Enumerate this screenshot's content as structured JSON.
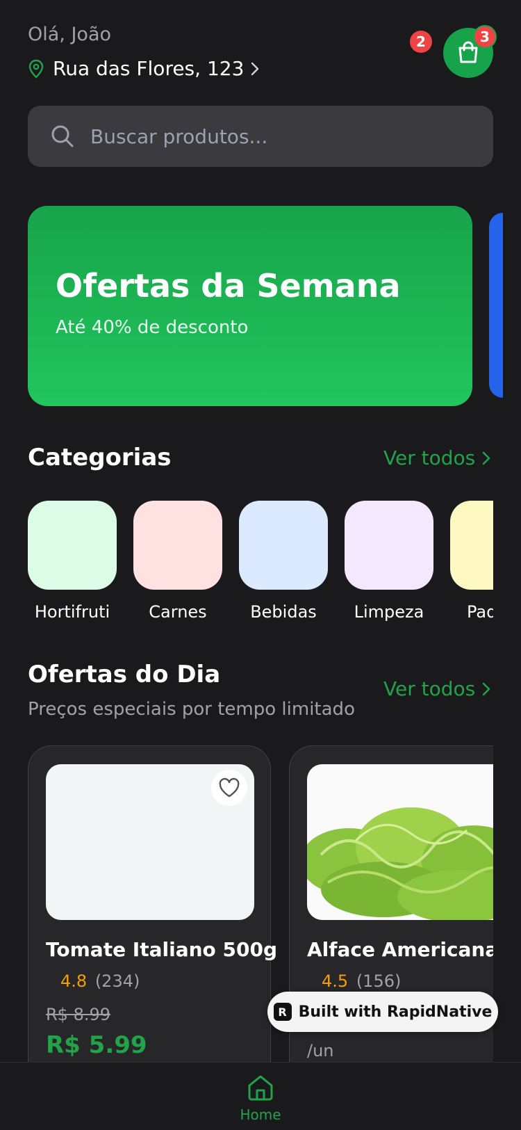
{
  "header": {
    "greeting": "Olá, João",
    "address": "Rua das Flores, 123",
    "notification_count": "2",
    "cart_count": "3"
  },
  "search": {
    "placeholder": "Buscar produtos..."
  },
  "promo": {
    "title": "Ofertas da Semana",
    "subtitle": "Até 40% de desconto"
  },
  "categories": {
    "title": "Categorias",
    "see_all": "Ver todos",
    "items": [
      {
        "label": "Hortifruti",
        "color": "#dcfce7"
      },
      {
        "label": "Carnes",
        "color": "#fee2e2"
      },
      {
        "label": "Bebidas",
        "color": "#dbeafe"
      },
      {
        "label": "Limpeza",
        "color": "#f3e8ff"
      },
      {
        "label": "Pad",
        "color": "#fef9c3"
      }
    ]
  },
  "daily_deals": {
    "title": "Ofertas do Dia",
    "subtitle": "Preços especiais por tempo limitado",
    "see_all": "Ver todos",
    "products": [
      {
        "name": "Tomate Italiano 500g",
        "rating": "4.8",
        "reviews": "(234)",
        "old_price": "R$ 8.99",
        "price": "R$ 5.99"
      },
      {
        "name": "Alface Americana",
        "rating": "4.5",
        "reviews": "(156)",
        "unit": "/un"
      }
    ]
  },
  "built_with": "Built with RapidNative",
  "tabbar": {
    "home_label": "Home"
  },
  "colors": {
    "accent": "#22a34a",
    "background": "#1a1a1d",
    "badge": "#ef4444",
    "rating": "#f59e0b"
  }
}
